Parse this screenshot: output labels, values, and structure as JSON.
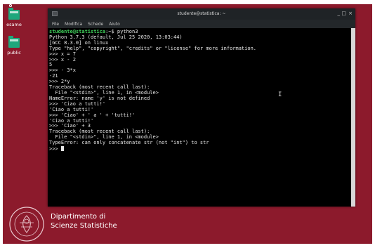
{
  "desktop": {
    "icons": [
      {
        "label": "esame",
        "icon": "folder-icon"
      },
      {
        "label": "public",
        "icon": "folder-icon"
      }
    ],
    "branding": {
      "dept_line1": "Dipartimento di",
      "dept_line2": "Scienze Statistiche"
    }
  },
  "window": {
    "title": "studente@statistica: ~",
    "controls": {
      "minimize": "_",
      "maximize": "□",
      "close": "×"
    },
    "menu": [
      "File",
      "Modifica",
      "Schede",
      "Aiuto"
    ]
  },
  "terminal": {
    "prompt_user": "studente@statistica",
    "prompt_rest": ":~$ python3",
    "lines": [
      "Python 3.7.3 (default, Jul 25 2020, 13:03:44)",
      "[GCC 8.3.0] on linux",
      "Type \"help\", \"copyright\", \"credits\" or \"license\" for more information.",
      ">>> x = 7",
      ">>> x - 2",
      "5",
      ">>> - 3*x",
      "-21",
      ">>> 2*y",
      "Traceback (most recent call last):",
      "  File \"<stdin>\", line 1, in <module>",
      "NameError: name 'y' is not defined",
      ">>> 'Ciao a tutti!'",
      "'Ciao a tutti!'",
      ">>> 'Ciao' + ' a ' + 'tutti!'",
      "'Ciao a tutti!'",
      ">>> 'Ciao' + 3",
      "Traceback (most recent call last):",
      "  File \"<stdin>\", line 1, in <module>",
      "TypeError: can only concatenate str (not \"int\") to str"
    ],
    "last_prompt": ">>> "
  },
  "colors": {
    "desktop_bg": "#8c1a2c",
    "prompt_green": "#3fd05a",
    "folder_teal": "#1fa77c"
  }
}
